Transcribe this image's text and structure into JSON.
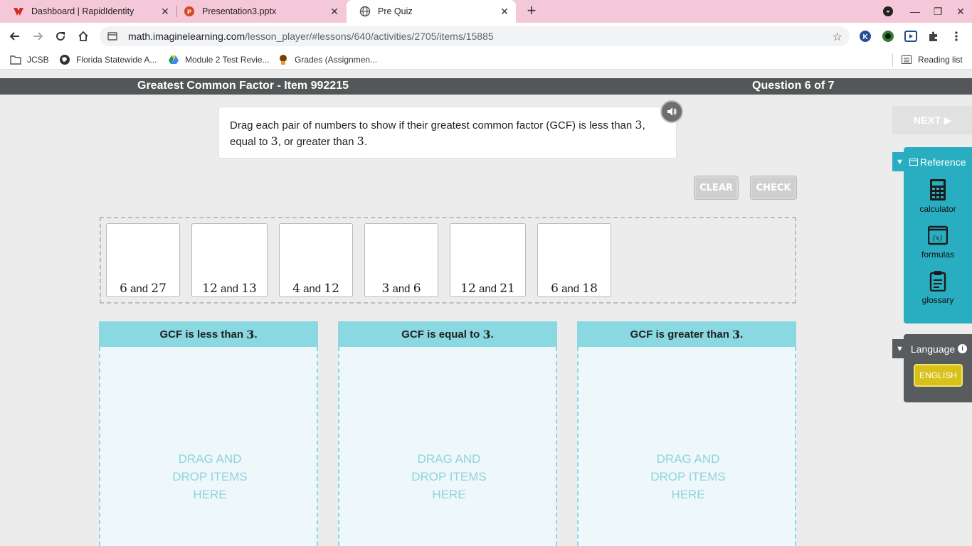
{
  "browser": {
    "tabs": [
      {
        "title": "Dashboard | RapidIdentity",
        "active": false
      },
      {
        "title": "Presentation3.pptx",
        "active": false
      },
      {
        "title": "Pre Quiz",
        "active": true
      }
    ],
    "url_host": "math.imaginelearning.com",
    "url_path": "/lesson_player/#lessons/640/activities/2705/items/15885",
    "bookmarks": [
      {
        "label": "JCSB",
        "icon": "folder-icon"
      },
      {
        "label": "Florida Statewide A...",
        "icon": "globe-icon"
      },
      {
        "label": "Module 2 Test Revie...",
        "icon": "google-drive-icon"
      },
      {
        "label": "Grades (Assignmen...",
        "icon": "grades-icon"
      }
    ],
    "reading_list": "Reading list"
  },
  "header": {
    "title": "Greatest Common Factor - Item 992215",
    "progress": "Question 6 of 7"
  },
  "instruction": {
    "part1": "Drag each pair of numbers to show if their greatest common factor (GCF) is less than ",
    "n1": "3",
    "part2": ", equal to ",
    "n2": "3",
    "part3": ", or greater than ",
    "n3": "3",
    "part4": "."
  },
  "buttons": {
    "clear": "CLEAR",
    "check": "CHECK",
    "next": "NEXT ▶"
  },
  "cards": [
    {
      "a": "6",
      "b": "27",
      "joiner": "and"
    },
    {
      "a": "12",
      "b": "13",
      "joiner": "and"
    },
    {
      "a": "4",
      "b": "12",
      "joiner": "and"
    },
    {
      "a": "3",
      "b": "6",
      "joiner": "and"
    },
    {
      "a": "12",
      "b": "21",
      "joiner": "and"
    },
    {
      "a": "6",
      "b": "18",
      "joiner": "and"
    }
  ],
  "bins": [
    {
      "label": "GCF is less than ",
      "n": "3",
      "end": ".",
      "hint1": "DRAG AND",
      "hint2": "DROP ITEMS",
      "hint3": "HERE"
    },
    {
      "label": "GCF is equal to ",
      "n": "3",
      "end": ".",
      "hint1": "DRAG AND",
      "hint2": "DROP ITEMS",
      "hint3": "HERE"
    },
    {
      "label": "GCF is greater than ",
      "n": "3",
      "end": ".",
      "hint1": "DRAG AND",
      "hint2": "DROP ITEMS",
      "hint3": "HERE"
    }
  ],
  "reference": {
    "title": "Reference",
    "tools": [
      {
        "label": "calculator",
        "icon": "calculator-icon"
      },
      {
        "label": "formulas",
        "icon": "formulas-icon"
      },
      {
        "label": "glossary",
        "icon": "glossary-icon"
      }
    ]
  },
  "language": {
    "title": "Language",
    "current": "ENGLISH"
  },
  "colors": {
    "accent": "#28aec0",
    "bin_header": "#8ad8e1",
    "header_bar": "#535758",
    "language_button": "#d8c21a"
  }
}
